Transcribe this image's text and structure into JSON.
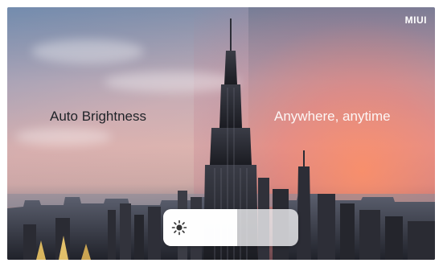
{
  "brand": "MIUI",
  "captions": {
    "left": "Auto Brightness",
    "right": "Anywhere, anytime"
  },
  "brightness": {
    "level": 0.55,
    "icon": "sun-icon"
  }
}
